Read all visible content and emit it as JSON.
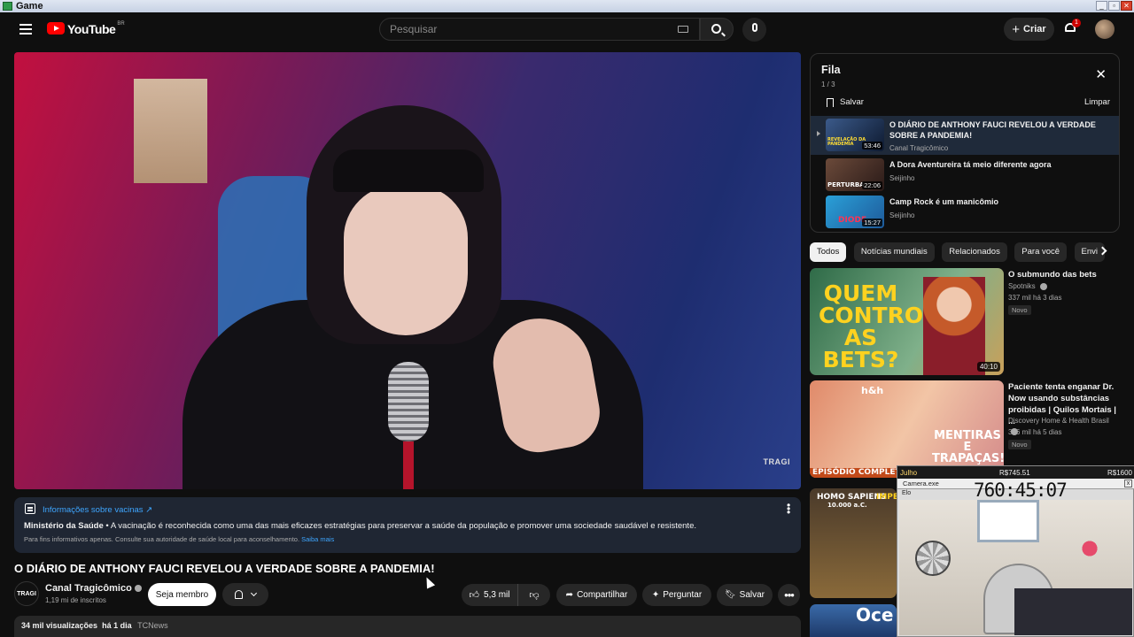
{
  "os": {
    "title": "Game",
    "controls": [
      "_",
      "▫",
      "✕"
    ]
  },
  "masthead": {
    "logo_text": "YouTube",
    "logo_region": "BR",
    "search_placeholder": "Pesquisar",
    "create_label": "Criar",
    "notification_count": "1"
  },
  "player": {
    "watermark": "TRAGI"
  },
  "info_panel": {
    "title": "Informações sobre vacinas ↗",
    "source": "Ministério da Saúde",
    "text": " • A vacinação é reconhecida como uma das mais eficazes estratégias para preservar a saúde da população e promover uma sociedade saudável e resistente.",
    "fine_print": "Para fins informativos apenas. Consulte sua autoridade de saúde local para aconselhamento.",
    "learn_more": "Saiba mais"
  },
  "video": {
    "title": "O DIÁRIO DE ANTHONY FAUCI REVELOU A VERDADE SOBRE A PANDEMIA!",
    "channel_avatar_text": "TRAGI",
    "channel_name": "Canal Tragicômico",
    "subscribers": "1,19 mi de inscritos",
    "member_label": "Seja membro",
    "likes": "5,3 mil",
    "share_label": "Compartilhar",
    "ask_label": "Perguntar",
    "save_label": "Salvar",
    "views": "34 mil visualizações",
    "age": "há 1 dia",
    "tag": "TCNews"
  },
  "queue": {
    "title": "Fila",
    "count": "1 / 3",
    "save_label": "Salvar",
    "clear_label": "Limpar",
    "items": [
      {
        "title": "O DIÁRIO DE ANTHONY FAUCI REVELOU A VERDADE SOBRE A PANDEMIA!",
        "channel": "Canal Tragicômico",
        "duration": "53:46",
        "thumb_text": "REVELAÇÃO DA PANDEMIA"
      },
      {
        "title": "A Dora Aventureira tá meio diferente agora",
        "channel": "Seijinho",
        "duration": "22:06",
        "thumb_text": "PERTURBA"
      },
      {
        "title": "Camp Rock é um manicômio",
        "channel": "Seijinho",
        "duration": "15:27",
        "thumb_text": "DIODE"
      }
    ]
  },
  "chips": [
    "Todos",
    "Notícias mundiais",
    "Relacionados",
    "Para você",
    "Envi"
  ],
  "recommendations": [
    {
      "title": "O submundo das bets",
      "channel": "Spotniks",
      "stats": "337 mil  há 3 dias",
      "badge": "Novo",
      "duration": "40:10",
      "thumb_text": "QUEM CONTROLA AS BETS?"
    },
    {
      "title": "Paciente tenta enganar Dr. Now usando substâncias proibidas | Quilos Mortais | ...",
      "channel": "Discovery Home & Health Brasil",
      "stats": "366 mil  há 5 dias",
      "badge": "Novo",
      "thumb_text": "MENTIRAS E TRAPAÇAS!",
      "thumb_logo": "h&h",
      "thumb_banner": "EPISÓDIO COMPLETO"
    },
    {
      "thumb_text_1": "HOMO SAPIENS",
      "thumb_text_2": "10.000 a.C.",
      "thumb_text_3": "IMPE"
    },
    {
      "thumb_text": "Oce"
    }
  ],
  "overlay": {
    "month": "Julho",
    "value1": "R$745.51",
    "value2": "R$1600",
    "window_title": "Camera.exe",
    "label": "Elo",
    "timer": "760:45:07"
  }
}
